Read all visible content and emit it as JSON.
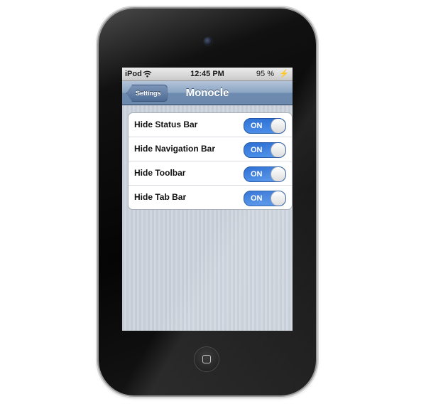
{
  "status_bar": {
    "carrier": "iPod",
    "time": "12:45 PM",
    "battery": "95 %"
  },
  "nav_bar": {
    "back_label": "Settings",
    "title": "Monocle"
  },
  "settings": {
    "items": [
      {
        "label": "Hide Status Bar",
        "switch_state": "ON"
      },
      {
        "label": "Hide Navigation Bar",
        "switch_state": "ON"
      },
      {
        "label": "Hide Toolbar",
        "switch_state": "ON"
      },
      {
        "label": "Hide Tab Bar",
        "switch_state": "ON"
      }
    ]
  },
  "colors": {
    "switch_on": "#2f72d6",
    "nav_bar": "#6d8bb0",
    "charging": "#2e9e2e"
  },
  "icons": {
    "wifi": "wifi-icon",
    "charging": "charging-bolt-icon",
    "home": "home-button-icon"
  }
}
